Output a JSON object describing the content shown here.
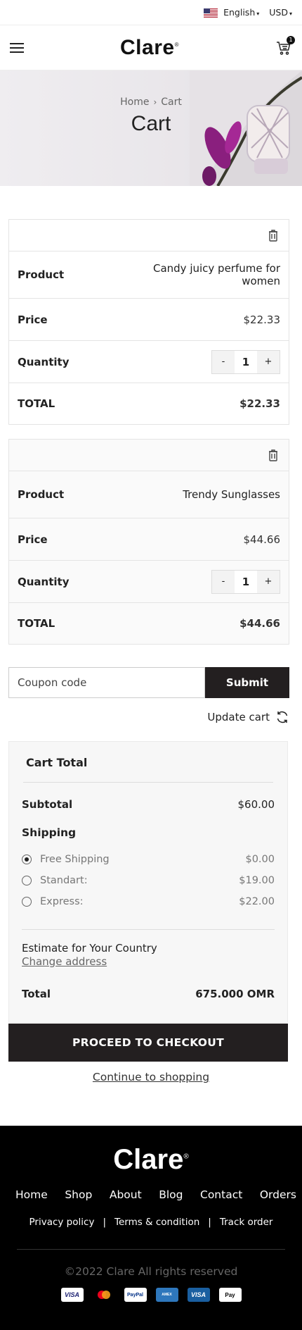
{
  "topbar": {
    "language": "English",
    "currency": "USD"
  },
  "header": {
    "logo": "Clare",
    "logo_mark": "®",
    "cart_count": "1"
  },
  "hero": {
    "breadcrumb_home": "Home",
    "breadcrumb_current": "Cart",
    "title": "Cart"
  },
  "items": [
    {
      "product_label": "Product",
      "product_name": "Candy juicy perfume for women",
      "price_label": "Price",
      "price": "$22.33",
      "quantity_label": "Quantity",
      "quantity": "1",
      "minus": "-",
      "plus": "+",
      "total_label": "TOTAL",
      "total": "$22.33"
    },
    {
      "product_label": "Product",
      "product_name": "Trendy Sunglasses",
      "price_label": "Price",
      "price": "$44.66",
      "quantity_label": "Quantity",
      "quantity": "1",
      "minus": "-",
      "plus": "+",
      "total_label": "TOTAL",
      "total": "$44.66"
    }
  ],
  "coupon": {
    "placeholder": "Coupon code",
    "submit": "Submit"
  },
  "update_cart": "Update cart",
  "cart_total": {
    "title": "Cart Total",
    "subtotal_label": "Subtotal",
    "subtotal": "$60.00",
    "shipping_label": "Shipping",
    "shipping_options": [
      {
        "label": "Free Shipping",
        "price": "$0.00",
        "selected": true
      },
      {
        "label": "Standart:",
        "price": "$19.00",
        "selected": false
      },
      {
        "label": "Express:",
        "price": "$22.00",
        "selected": false
      }
    ],
    "estimate_label": "Estimate for Your Country",
    "change_address": "Change address",
    "total_label": "Total",
    "total": "675.000 OMR"
  },
  "checkout_button": "PROCEED TO CHECKOUT",
  "continue_link": "Continue to shopping",
  "footer": {
    "logo": "Clare",
    "logo_mark": "®",
    "nav": [
      "Home",
      "Shop",
      "About",
      "Blog",
      "Contact",
      "Orders"
    ],
    "links": [
      "Privacy policy",
      "Terms & condition",
      "Track order"
    ],
    "copyright": "©2022 Clare All rights reserved",
    "payments": [
      "visa-icon",
      "mastercard-icon",
      "paypal-icon",
      "amex-icon",
      "visa-electron-icon",
      "apple-pay-icon"
    ]
  }
}
